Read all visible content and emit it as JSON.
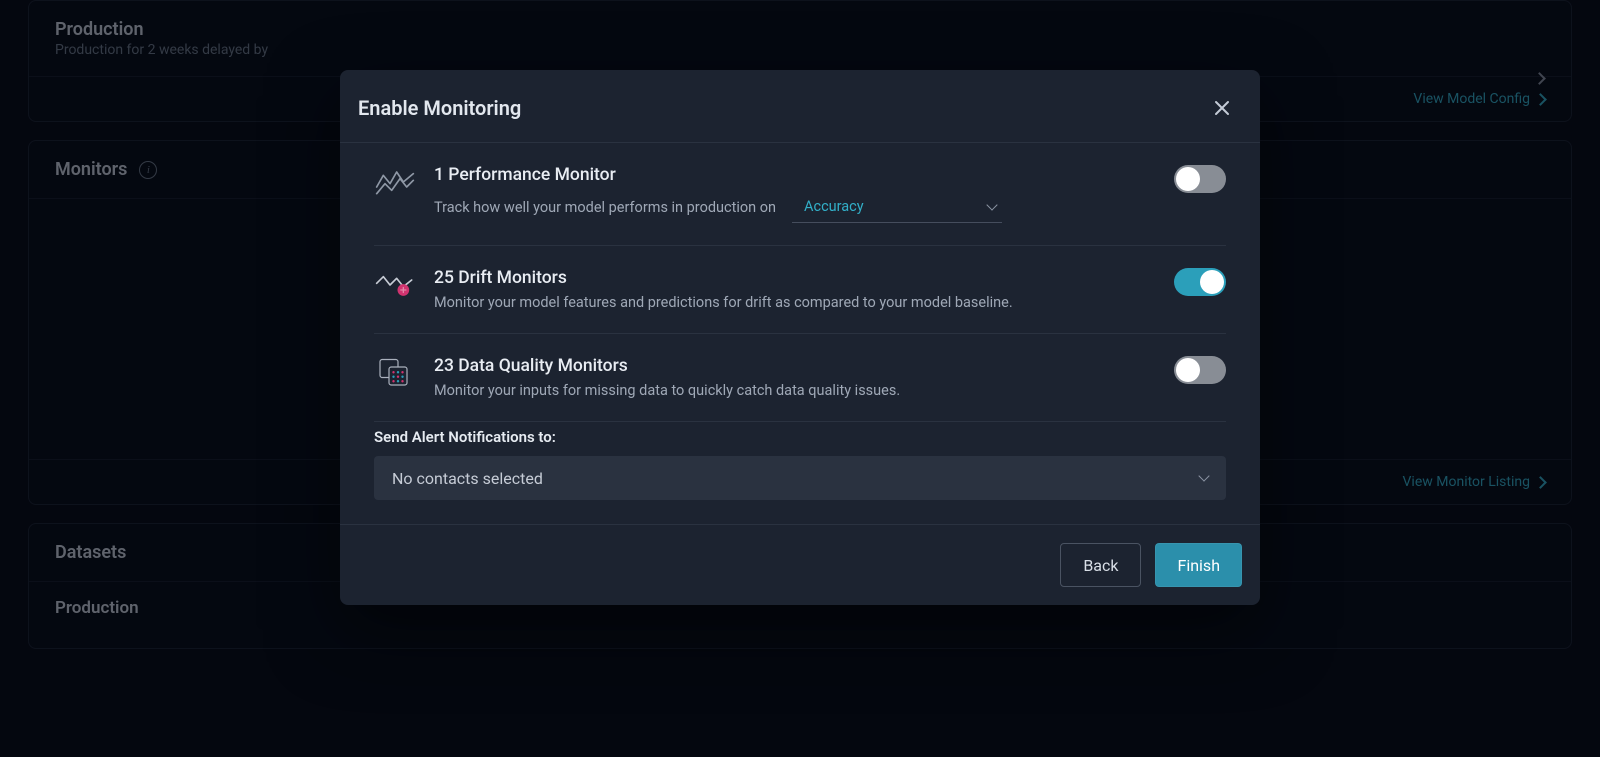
{
  "background": {
    "production_panel": {
      "title": "Production",
      "subtitle_prefix": "Production for 2 weeks delayed by",
      "view_model_config": "View Model Config"
    },
    "monitors_panel": {
      "title": "Monitors",
      "view_monitor_listing": "View Monitor Listing"
    },
    "datasets_panel": {
      "title": "Datasets",
      "item_title": "Production"
    }
  },
  "modal": {
    "title": "Enable Monitoring",
    "rows": {
      "performance": {
        "title": "1 Performance Monitor",
        "desc_prefix": "Track how well your model performs in production on",
        "metric_selected": "Accuracy",
        "enabled": false
      },
      "drift": {
        "title": "25 Drift Monitors",
        "desc": "Monitor your model features and predictions for drift as compared to your model baseline.",
        "enabled": true
      },
      "data_quality": {
        "title": "23 Data Quality Monitors",
        "desc": "Monitor your inputs for missing data to quickly catch data quality issues.",
        "enabled": false
      }
    },
    "alerts": {
      "label": "Send Alert Notifications to:",
      "selected_text": "No contacts selected"
    },
    "buttons": {
      "back": "Back",
      "finish": "Finish"
    }
  }
}
